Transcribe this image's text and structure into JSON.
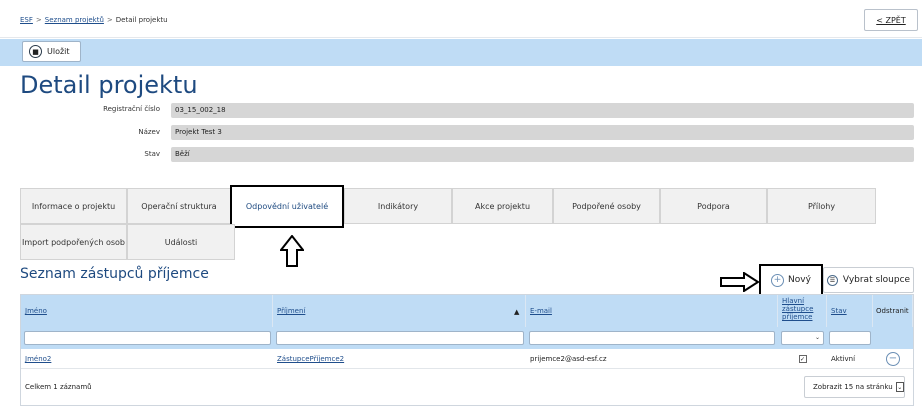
{
  "breadcrumb": [
    "ESF",
    "Seznam projektů",
    "Detail projektu"
  ],
  "back_label": "< ZPĚT",
  "toolbar": {
    "save_label": "Uložit"
  },
  "page_title": "Detail projektu",
  "info": [
    {
      "label": "Registrační číslo",
      "value": "03_15_002_18"
    },
    {
      "label": "Název",
      "value": "Projekt Test 3"
    },
    {
      "label": "Stav",
      "value": "Běží"
    }
  ],
  "tabs": [
    "Informace o projektu",
    "Operační struktura",
    "Odpovědní uživatelé",
    "Indikátory",
    "Akce projektu",
    "Podpořené osoby",
    "Podpora",
    "Přílohy",
    "Import podpořených osob",
    "Události"
  ],
  "active_tab": "Odpovědní uživatelé",
  "section_title": "Seznam zástupců příjemce",
  "buttons": {
    "new_label": "Nový",
    "columns_label": "Vybrat sloupce"
  },
  "grid": {
    "columns": [
      "Jméno",
      "Příjmení",
      "E-mail",
      "Hlavní zástupce příjemce",
      "Stav",
      "Odstranit"
    ],
    "sort_symbol": "▲",
    "rows": [
      {
        "jmeno": "Jméno2",
        "prijmeni": "ZástupcePříjemce2",
        "email": "prijemce2@asd-esf.cz",
        "hlavni": true,
        "stav": "Aktivní"
      }
    ],
    "total": "Celkem 1 záznamů",
    "page_size": "Zobrazit 15 na stránku"
  }
}
